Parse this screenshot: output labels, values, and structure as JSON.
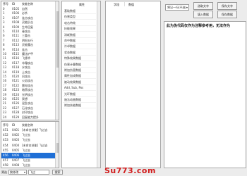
{
  "top_list": {
    "headers": {
      "seq": "序号",
      "id": "ID",
      "name": "技能名称"
    },
    "rows": [
      {
        "seq": "0",
        "id": "0105",
        "name": "自然"
      },
      {
        "seq": "1",
        "id": "0106",
        "name": "必杀"
      },
      {
        "seq": "2",
        "id": "0107",
        "name": "连击攻击"
      },
      {
        "seq": "3",
        "id": "0108",
        "name": "灵能反击"
      },
      {
        "seq": "4",
        "id": "0109",
        "name": "生命回复"
      },
      {
        "seq": "5",
        "id": "0110",
        "name": "毒攻击"
      },
      {
        "seq": "6",
        "id": "0111",
        "name": "三重击"
      },
      {
        "seq": "7",
        "id": "0112",
        "name": "阴阳五行"
      },
      {
        "seq": "8",
        "id": "0113",
        "name": "灵能魔击"
      },
      {
        "seq": "9",
        "id": "0114",
        "name": "连击"
      },
      {
        "seq": "10",
        "id": "0115",
        "name": "魔法护甲"
      },
      {
        "seq": "11",
        "id": "0116",
        "name": "飞镖术"
      },
      {
        "seq": "12",
        "id": "0117",
        "name": "冰霜攻击"
      },
      {
        "seq": "13",
        "id": "0118",
        "name": "水攻击"
      },
      {
        "seq": "14",
        "id": "0119",
        "name": "土攻击"
      },
      {
        "seq": "15",
        "id": "0120",
        "name": "风攻击"
      },
      {
        "seq": "16",
        "id": "0121",
        "name": "火焰攻击"
      },
      {
        "seq": "17",
        "id": "0122",
        "name": "雷电攻击"
      },
      {
        "seq": "18",
        "id": "0123",
        "name": "暗黑攻击"
      },
      {
        "seq": "19",
        "id": "0124",
        "name": "光明攻击"
      },
      {
        "seq": "20",
        "id": "0125",
        "name": "冥想"
      },
      {
        "seq": "21",
        "id": "0126",
        "name": "混乱攻击"
      },
      {
        "seq": "22",
        "id": "0127",
        "name": "石化攻击"
      },
      {
        "seq": "23",
        "id": "0128",
        "name": "封印攻击"
      },
      {
        "seq": "24",
        "id": "0129",
        "name": "回复能力提升"
      }
    ]
  },
  "bottom_list": {
    "headers": {
      "seq": "序号",
      "id": "ID",
      "name": "技能名称"
    },
    "rows": [
      {
        "seq": "451",
        "id": "0401",
        "name": "[未命名技能] 飞过去"
      },
      {
        "seq": "452",
        "id": "0402",
        "name": "飞过去"
      },
      {
        "seq": "453",
        "id": "0403",
        "name": "飞过去"
      },
      {
        "seq": "454",
        "id": "0404",
        "name": "[未命名技能] 飞过去"
      },
      {
        "seq": "455",
        "id": "0405",
        "name": "飞过去"
      },
      {
        "seq": "456",
        "id": "0406",
        "name": "飞过去",
        "selected": true
      },
      {
        "seq": "457",
        "id": "0407",
        "name": "飞过去"
      },
      {
        "seq": "458",
        "id": "0408",
        "name": "飞过去"
      }
    ]
  },
  "search": {
    "label": "筛选",
    "category": "按修改",
    "input": "飞过",
    "button": "搜索"
  },
  "attributes": {
    "header": "属性",
    "items": [
      "基础数据",
      "伤害类型",
      "攻击特效",
      "技能效果",
      "消耗数据",
      "命中数据",
      "冷却数据",
      "状态数据",
      "特殊效果数据",
      "伤害计算数据",
      "附加伤害数据",
      "属性加成数据",
      "被动效果数据",
      "Add, Sub, Pos",
      "光环数据",
      "施法动画数据",
      "附加技能数据"
    ]
  },
  "values": {
    "col1": "字段",
    "col2": "数值"
  },
  "toolbar": {
    "dropdown": "将记一行(不选)",
    "btn_select_text": "选取文字",
    "btn_save_text": "保存文字",
    "btn_write_data": "填入数据",
    "btn_save_data": "保存数据"
  },
  "notice": "此为伪代码仅作为注释参考用，无法作为",
  "watermark": "Su773.com"
}
